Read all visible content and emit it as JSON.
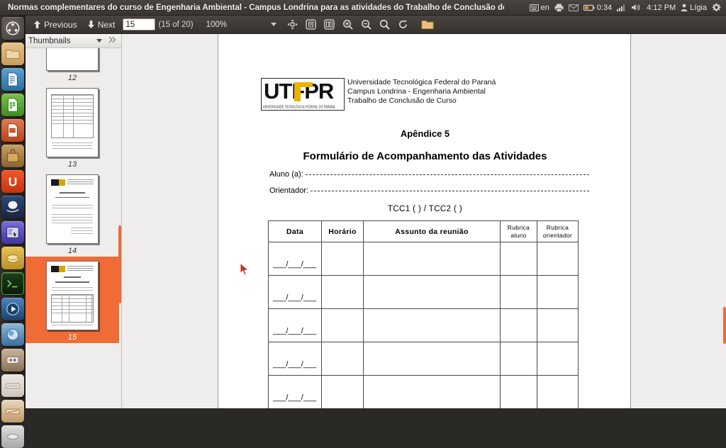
{
  "window": {
    "title": "Normas complementares do curso de Engenharia Ambiental - Campus Londrina para as atividades do Trabalho de Conclusão de Curso ("
  },
  "panel_indicators": {
    "keyboard_layout": "en",
    "battery_time": "0:34",
    "clock": "4:12 PM",
    "user": "Lígia",
    "icons": [
      "keyboard-icon",
      "printer-icon",
      "mail-icon",
      "battery-icon",
      "signal-icon",
      "volume-icon",
      "user-icon",
      "gear-icon"
    ]
  },
  "launcher": {
    "items": [
      {
        "name": "ubuntu-dash",
        "label": "Dash Home"
      },
      {
        "name": "files",
        "label": "Files"
      },
      {
        "name": "libreoffice-writer",
        "label": "LibreOffice Writer"
      },
      {
        "name": "libreoffice-calc",
        "label": "LibreOffice Calc"
      },
      {
        "name": "libreoffice-impress",
        "label": "LibreOffice Impress"
      },
      {
        "name": "ubuntu-software-center",
        "label": "Ubuntu Software Center"
      },
      {
        "name": "ubuntu-one",
        "label": "Ubuntu One"
      },
      {
        "name": "amazon",
        "label": "Amazon"
      },
      {
        "name": "system-settings",
        "label": "System Settings"
      },
      {
        "name": "workspace-switcher",
        "label": "Workspace Switcher"
      },
      {
        "name": "terminal",
        "label": "Terminal"
      },
      {
        "name": "media-player",
        "label": "Media Player"
      },
      {
        "name": "web-browser",
        "label": "Web Browser"
      },
      {
        "name": "stack-1",
        "label": ""
      },
      {
        "name": "stack-2",
        "label": ""
      },
      {
        "name": "stack-3",
        "label": ""
      },
      {
        "name": "stack-4",
        "label": ""
      }
    ]
  },
  "toolbar": {
    "previous_label": "Previous",
    "next_label": "Next",
    "page_value": "15",
    "page_count_label": "(15 of 20)",
    "zoom_label": "100%",
    "icons": [
      "previous-arrow-icon",
      "next-arrow-icon",
      "select-tool-icon",
      "fit-page-icon",
      "fit-width-icon",
      "zoom-in-icon",
      "zoom-out-icon",
      "search-icon",
      "rotate-icon",
      "folder-icon"
    ]
  },
  "sidebar": {
    "title": "Thumbnails",
    "thumbnails": [
      {
        "label": "12",
        "selected": false,
        "kind": "lines"
      },
      {
        "label": "13",
        "selected": false,
        "kind": "table"
      },
      {
        "label": "14",
        "selected": false,
        "kind": "letter"
      },
      {
        "label": "15",
        "selected": true,
        "kind": "form"
      }
    ]
  },
  "document": {
    "logo_text": "UTFPR",
    "logo_subtitle": "UNIVERSIDADE TECNOLÓGICA FEDERAL DO PARANÁ",
    "header_lines": [
      "Universidade Tecnológica Federal do Paraná",
      "Campus Londrina - Engenharia Ambiental",
      "Trabalho de Conclusão de Curso"
    ],
    "appendix": "Apêndice 5",
    "form_title": "Formulário de Acompanhamento das Atividades",
    "fields": [
      {
        "label": "Aluno (a):",
        "value": ""
      },
      {
        "label": "Orientador:",
        "value": ""
      }
    ],
    "tcc_line": "TCC1 (    )   /   TCC2 (    )",
    "table": {
      "headers": [
        "Data",
        "Horário",
        "Assunto da reunião",
        "Rubrica aluno",
        "Rubrica orientador"
      ],
      "rows": [
        {
          "date": "___/___/___",
          "time": "",
          "subject": "",
          "rubrica_aluno": "",
          "rubrica_orientador": ""
        },
        {
          "date": "___/___/___",
          "time": "",
          "subject": "",
          "rubrica_aluno": "",
          "rubrica_orientador": ""
        },
        {
          "date": "___/___/___",
          "time": "",
          "subject": "",
          "rubrica_aluno": "",
          "rubrica_orientador": ""
        },
        {
          "date": "___/___/___",
          "time": "",
          "subject": "",
          "rubrica_aluno": "",
          "rubrica_orientador": ""
        },
        {
          "date": "___/___/___",
          "time": "",
          "subject": "",
          "rubrica_aluno": "",
          "rubrica_orientador": ""
        }
      ]
    }
  },
  "colors": {
    "accent_orange": "#ef6c36",
    "panel_dark": "#3a3531",
    "logo_yellow": "#e8b400"
  }
}
